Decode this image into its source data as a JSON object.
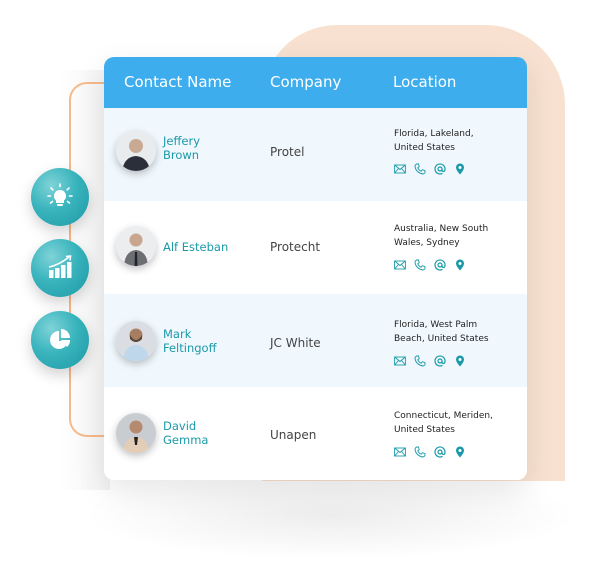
{
  "colors": {
    "header_bg": "#3DADEE",
    "accent_teal": "#1A9AA8",
    "row_alt_bg": "#F0F8FE",
    "peach_bg": "#F8E1D0",
    "bracket_orange": "#F5B98A"
  },
  "side_buttons": [
    {
      "icon": "lightbulb-icon"
    },
    {
      "icon": "growth-chart-icon"
    },
    {
      "icon": "pie-chart-icon"
    }
  ],
  "table": {
    "headers": {
      "name": "Contact Name",
      "company": "Company",
      "location": "Location"
    },
    "rows": [
      {
        "name_line1": "Jeffery",
        "name_line2": "Brown",
        "company": "Protel",
        "location_line1": "Florida, Lakeland,",
        "location_line2": "United States",
        "actions": [
          "mail-icon",
          "phone-icon",
          "at-icon",
          "location-pin-icon"
        ]
      },
      {
        "name_line1": "Alf Esteban",
        "name_line2": "",
        "company": "Protecht",
        "location_line1": "Australia, New South",
        "location_line2": "Wales, Sydney",
        "actions": [
          "mail-icon",
          "phone-icon",
          "at-icon",
          "location-pin-icon"
        ]
      },
      {
        "name_line1": "Mark",
        "name_line2": "Feltingoff",
        "company": "JC White",
        "location_line1": "Florida, West Palm",
        "location_line2": "Beach, United States",
        "actions": [
          "mail-icon",
          "phone-icon",
          "at-icon",
          "location-pin-icon"
        ]
      },
      {
        "name_line1": "David",
        "name_line2": "Gemma",
        "company": "Unapen",
        "location_line1": "Connecticut, Meriden,",
        "location_line2": "United States",
        "actions": [
          "mail-icon",
          "phone-icon",
          "at-icon",
          "location-pin-icon"
        ]
      }
    ]
  }
}
